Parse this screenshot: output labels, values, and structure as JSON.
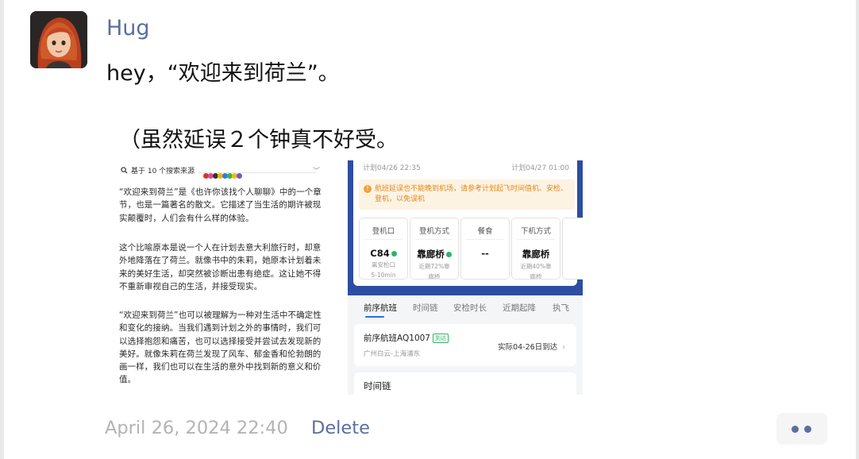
{
  "message": {
    "author": "Hug",
    "line1": "hey，“欢迎来到荷兰”。",
    "line2": "（虽然延误２个钟真不好受。",
    "timestamp": "April 26, 2024 22:40",
    "delete_label": "Delete"
  },
  "search_shot": {
    "header": "基于 10 个搜索来源",
    "paragraphs": [
      "“欢迎来到荷兰”是《也许你该找个人聊聊》中的一个章节，也是一篇著名的散文。它描述了当生活的期许被现实颠覆时，人们会有什么样的体验。",
      "这个比喻原本是说一个人在计划去意大利旅行时，却意外地降落在了荷兰。就像书中的朱莉，她原本计划着未来的美好生活，却突然被诊断出患有绝症。这让她不得不重新审视自己的生活，并接受现实。",
      "“欢迎来到荷兰”也可以被理解为一种对生活中不确定性和变化的接纳。当我们遇到计划之外的事情时，我们可以选择抱怨和痛苦，也可以选择接受并尝试去发现新的美好。就像朱莉在荷兰发现了风车、郁金香和伦勃朗的画一样，我们也可以在生活的意外中找到新的意义和价值。"
    ]
  },
  "flight_shot": {
    "time_left": "计划04/26 22:35",
    "time_right": "计划04/27 01:00",
    "warning": "航班延误也不能晚到机场，请参考计划起飞时间值机、安检、登机，以免误机",
    "tiles": [
      {
        "label": "登机口",
        "value": "C84",
        "sub1": "离安检口",
        "sub2": "5-10min"
      },
      {
        "label": "登机方式",
        "value": "靠廊桥",
        "sub1": "近期72%靠",
        "sub2": "廊桥"
      },
      {
        "label": "餐食",
        "value": "--",
        "sub1": "",
        "sub2": ""
      },
      {
        "label": "下机方式",
        "value": "靠廊桥",
        "sub1": "近期40%靠",
        "sub2": "廊桥"
      }
    ],
    "tabs": [
      "前序航班",
      "时间链",
      "安检时长",
      "近期起降",
      "执飞"
    ],
    "prev_flight": {
      "title": "前序航班AQ1007",
      "badge": "到达",
      "route": "广州白云-上海浦东",
      "status": "实际04-26日到达"
    },
    "time_chain_title": "时间链"
  },
  "colors": {
    "link": "#5b6f9e",
    "flight_blue": "#2d4ea0",
    "warning_orange": "#e08a1c"
  }
}
